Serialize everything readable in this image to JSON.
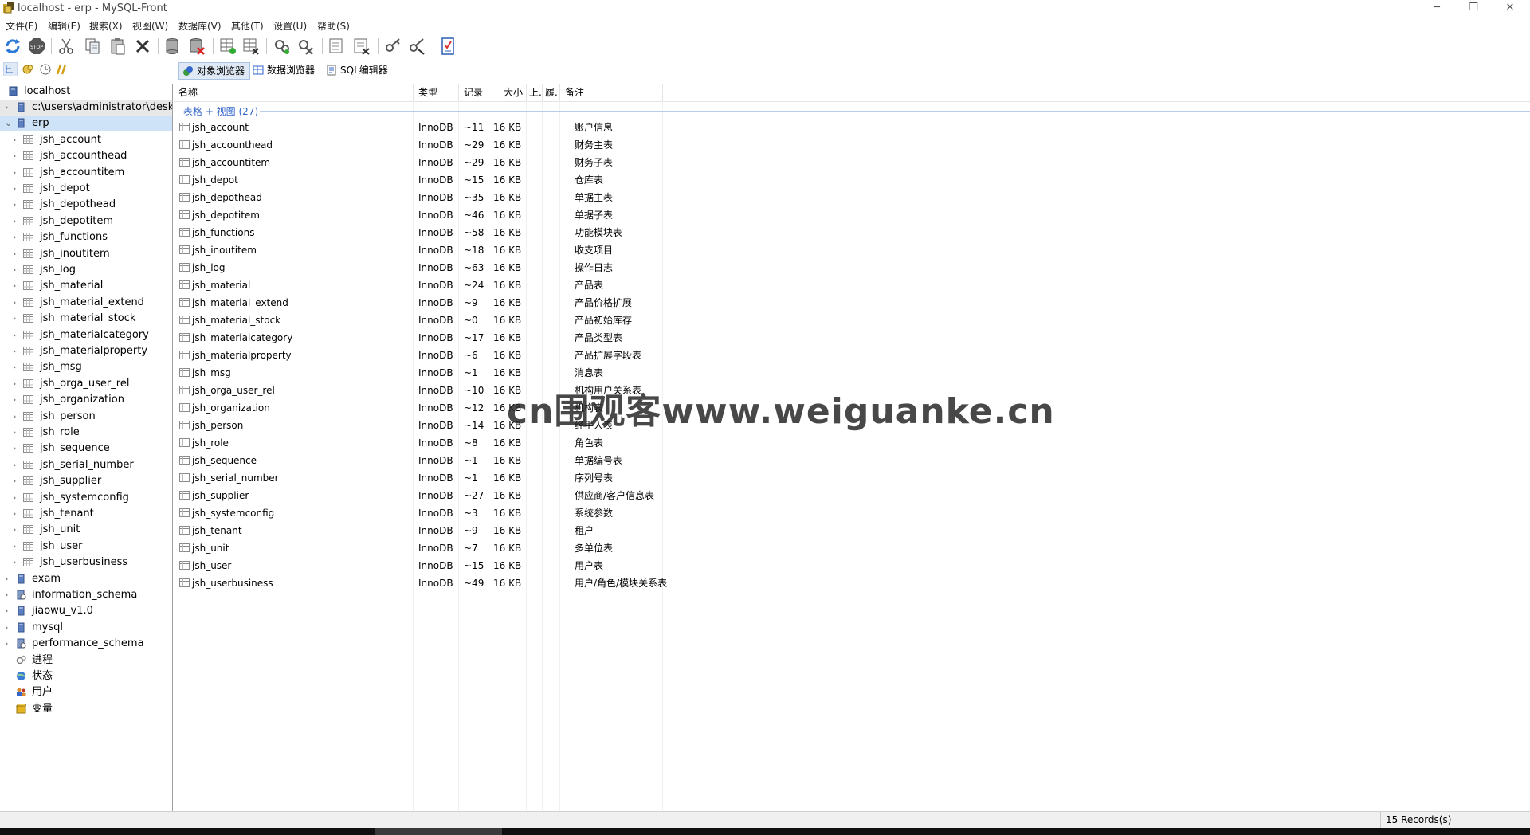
{
  "window": {
    "title": "localhost - erp - MySQL-Front",
    "buttons": {
      "minimize": "─",
      "restore": "❐",
      "close": "✕"
    }
  },
  "menu": [
    "文件(F)",
    "编辑(E)",
    "搜索(X)",
    "视图(W)",
    "数据库(V)",
    "其他(T)",
    "设置(U)",
    "帮助(S)"
  ],
  "toolbar": {
    "icons": [
      "refresh-icon",
      "stop-icon",
      "cut-icon",
      "copy-icon",
      "paste-icon",
      "delete-icon",
      "database-new-icon",
      "database-drop-icon",
      "table-new-icon",
      "table-drop-icon",
      "field-new-icon",
      "field-drop-icon",
      "index-new-icon",
      "index-drop-icon",
      "foreign-key-new-icon",
      "foreign-key-drop-icon",
      "checklist-icon"
    ],
    "stop_label": "STOP"
  },
  "tabs": [
    {
      "label": "对象浏览器",
      "active": true
    },
    {
      "label": "数据浏览器",
      "active": false
    },
    {
      "label": "SQL编辑器",
      "active": false
    }
  ],
  "tree": {
    "root": "localhost",
    "nodes": [
      {
        "label": "c:\\users\\administrator\\deskto",
        "type": "database",
        "level": 1,
        "expander": "›"
      },
      {
        "label": "erp",
        "type": "database",
        "level": 1,
        "expander": "⌄",
        "selected": true
      },
      {
        "label": "jsh_account",
        "type": "table",
        "level": 2,
        "expander": "›"
      },
      {
        "label": "jsh_accounthead",
        "type": "table",
        "level": 2,
        "expander": "›"
      },
      {
        "label": "jsh_accountitem",
        "type": "table",
        "level": 2,
        "expander": "›"
      },
      {
        "label": "jsh_depot",
        "type": "table",
        "level": 2,
        "expander": "›"
      },
      {
        "label": "jsh_depothead",
        "type": "table",
        "level": 2,
        "expander": "›"
      },
      {
        "label": "jsh_depotitem",
        "type": "table",
        "level": 2,
        "expander": "›"
      },
      {
        "label": "jsh_functions",
        "type": "table",
        "level": 2,
        "expander": "›"
      },
      {
        "label": "jsh_inoutitem",
        "type": "table",
        "level": 2,
        "expander": "›"
      },
      {
        "label": "jsh_log",
        "type": "table",
        "level": 2,
        "expander": "›"
      },
      {
        "label": "jsh_material",
        "type": "table",
        "level": 2,
        "expander": "›"
      },
      {
        "label": "jsh_material_extend",
        "type": "table",
        "level": 2,
        "expander": "›"
      },
      {
        "label": "jsh_material_stock",
        "type": "table",
        "level": 2,
        "expander": "›"
      },
      {
        "label": "jsh_materialcategory",
        "type": "table",
        "level": 2,
        "expander": "›"
      },
      {
        "label": "jsh_materialproperty",
        "type": "table",
        "level": 2,
        "expander": "›"
      },
      {
        "label": "jsh_msg",
        "type": "table",
        "level": 2,
        "expander": "›"
      },
      {
        "label": "jsh_orga_user_rel",
        "type": "table",
        "level": 2,
        "expander": "›"
      },
      {
        "label": "jsh_organization",
        "type": "table",
        "level": 2,
        "expander": "›"
      },
      {
        "label": "jsh_person",
        "type": "table",
        "level": 2,
        "expander": "›"
      },
      {
        "label": "jsh_role",
        "type": "table",
        "level": 2,
        "expander": "›"
      },
      {
        "label": "jsh_sequence",
        "type": "table",
        "level": 2,
        "expander": "›"
      },
      {
        "label": "jsh_serial_number",
        "type": "table",
        "level": 2,
        "expander": "›"
      },
      {
        "label": "jsh_supplier",
        "type": "table",
        "level": 2,
        "expander": "›"
      },
      {
        "label": "jsh_systemconfig",
        "type": "table",
        "level": 2,
        "expander": "›"
      },
      {
        "label": "jsh_tenant",
        "type": "table",
        "level": 2,
        "expander": "›"
      },
      {
        "label": "jsh_unit",
        "type": "table",
        "level": 2,
        "expander": "›"
      },
      {
        "label": "jsh_user",
        "type": "table",
        "level": 2,
        "expander": "›"
      },
      {
        "label": "jsh_userbusiness",
        "type": "table",
        "level": 2,
        "expander": "›"
      },
      {
        "label": "exam",
        "type": "database",
        "level": 1,
        "expander": "›"
      },
      {
        "label": "information_schema",
        "type": "system-database",
        "level": 1,
        "expander": "›"
      },
      {
        "label": "jiaowu_v1.0",
        "type": "database",
        "level": 1,
        "expander": "›"
      },
      {
        "label": "mysql",
        "type": "database",
        "level": 1,
        "expander": "›"
      },
      {
        "label": "performance_schema",
        "type": "system-database",
        "level": 1,
        "expander": "›"
      },
      {
        "label": "进程",
        "type": "processes",
        "level": 1,
        "expander": ""
      },
      {
        "label": "状态",
        "type": "status",
        "level": 1,
        "expander": ""
      },
      {
        "label": "用户",
        "type": "users",
        "level": 1,
        "expander": ""
      },
      {
        "label": "变量",
        "type": "variables",
        "level": 1,
        "expander": ""
      }
    ]
  },
  "table": {
    "columns": [
      "名称",
      "类型",
      "记录",
      "大小",
      "上.",
      "履.",
      "备注"
    ],
    "group_label": "表格 + 视图 (27)",
    "rows": [
      {
        "name": "jsh_account",
        "type": "InnoDB",
        "records": "~11",
        "size": "16 KB",
        "comment": "账户信息"
      },
      {
        "name": "jsh_accounthead",
        "type": "InnoDB",
        "records": "~29",
        "size": "16 KB",
        "comment": "财务主表"
      },
      {
        "name": "jsh_accountitem",
        "type": "InnoDB",
        "records": "~29",
        "size": "16 KB",
        "comment": "财务子表"
      },
      {
        "name": "jsh_depot",
        "type": "InnoDB",
        "records": "~15",
        "size": "16 KB",
        "comment": "仓库表"
      },
      {
        "name": "jsh_depothead",
        "type": "InnoDB",
        "records": "~35",
        "size": "16 KB",
        "comment": "单据主表"
      },
      {
        "name": "jsh_depotitem",
        "type": "InnoDB",
        "records": "~46",
        "size": "16 KB",
        "comment": "单据子表"
      },
      {
        "name": "jsh_functions",
        "type": "InnoDB",
        "records": "~58",
        "size": "16 KB",
        "comment": "功能模块表"
      },
      {
        "name": "jsh_inoutitem",
        "type": "InnoDB",
        "records": "~18",
        "size": "16 KB",
        "comment": "收支项目"
      },
      {
        "name": "jsh_log",
        "type": "InnoDB",
        "records": "~63",
        "size": "16 KB",
        "comment": "操作日志"
      },
      {
        "name": "jsh_material",
        "type": "InnoDB",
        "records": "~24",
        "size": "16 KB",
        "comment": "产品表"
      },
      {
        "name": "jsh_material_extend",
        "type": "InnoDB",
        "records": "~9",
        "size": "16 KB",
        "comment": "产品价格扩展"
      },
      {
        "name": "jsh_material_stock",
        "type": "InnoDB",
        "records": "~0",
        "size": "16 KB",
        "comment": "产品初始库存"
      },
      {
        "name": "jsh_materialcategory",
        "type": "InnoDB",
        "records": "~17",
        "size": "16 KB",
        "comment": "产品类型表"
      },
      {
        "name": "jsh_materialproperty",
        "type": "InnoDB",
        "records": "~6",
        "size": "16 KB",
        "comment": "产品扩展字段表"
      },
      {
        "name": "jsh_msg",
        "type": "InnoDB",
        "records": "~1",
        "size": "16 KB",
        "comment": "消息表"
      },
      {
        "name": "jsh_orga_user_rel",
        "type": "InnoDB",
        "records": "~10",
        "size": "16 KB",
        "comment": "机构用户关系表"
      },
      {
        "name": "jsh_organization",
        "type": "InnoDB",
        "records": "~12",
        "size": "16 KB",
        "comment": "机构表"
      },
      {
        "name": "jsh_person",
        "type": "InnoDB",
        "records": "~14",
        "size": "16 KB",
        "comment": "经手人表"
      },
      {
        "name": "jsh_role",
        "type": "InnoDB",
        "records": "~8",
        "size": "16 KB",
        "comment": "角色表"
      },
      {
        "name": "jsh_sequence",
        "type": "InnoDB",
        "records": "~1",
        "size": "16 KB",
        "comment": "单据编号表"
      },
      {
        "name": "jsh_serial_number",
        "type": "InnoDB",
        "records": "~1",
        "size": "16 KB",
        "comment": "序列号表"
      },
      {
        "name": "jsh_supplier",
        "type": "InnoDB",
        "records": "~27",
        "size": "16 KB",
        "comment": "供应商/客户信息表"
      },
      {
        "name": "jsh_systemconfig",
        "type": "InnoDB",
        "records": "~3",
        "size": "16 KB",
        "comment": "系统参数"
      },
      {
        "name": "jsh_tenant",
        "type": "InnoDB",
        "records": "~9",
        "size": "16 KB",
        "comment": "租户"
      },
      {
        "name": "jsh_unit",
        "type": "InnoDB",
        "records": "~7",
        "size": "16 KB",
        "comment": "多单位表"
      },
      {
        "name": "jsh_user",
        "type": "InnoDB",
        "records": "~15",
        "size": "16 KB",
        "comment": "用户表"
      },
      {
        "name": "jsh_userbusiness",
        "type": "InnoDB",
        "records": "~49",
        "size": "16 KB",
        "comment": "用户/角色/模块关系表"
      }
    ]
  },
  "status": {
    "records": "15 Records(s)"
  },
  "watermark": "cn围观客www.weiguanke.cn"
}
